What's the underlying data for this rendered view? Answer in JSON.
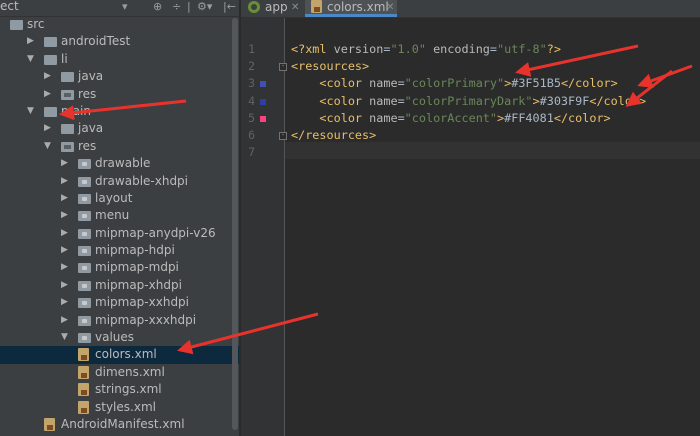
{
  "panel": {
    "title": "ect"
  },
  "tree": [
    {
      "label": "src",
      "depth": 0,
      "arrow": "",
      "icon": "folder",
      "selected": false
    },
    {
      "label": "androidTest",
      "depth": 1,
      "arrow": "right",
      "icon": "folder",
      "selected": false
    },
    {
      "label": "li",
      "depth": 1,
      "arrow": "down",
      "icon": "folder",
      "selected": false
    },
    {
      "label": "java",
      "depth": 2,
      "arrow": "right",
      "icon": "folder",
      "selected": false
    },
    {
      "label": "res",
      "depth": 2,
      "arrow": "right",
      "icon": "res-folder",
      "selected": false
    },
    {
      "label": "main",
      "depth": 1,
      "arrow": "down",
      "icon": "folder",
      "selected": false
    },
    {
      "label": "java",
      "depth": 2,
      "arrow": "right",
      "icon": "folder",
      "selected": false
    },
    {
      "label": "res",
      "depth": 2,
      "arrow": "down",
      "icon": "res-folder",
      "selected": false
    },
    {
      "label": "drawable",
      "depth": 3,
      "arrow": "right",
      "icon": "package-folder",
      "selected": false
    },
    {
      "label": "drawable-xhdpi",
      "depth": 3,
      "arrow": "right",
      "icon": "package-folder",
      "selected": false
    },
    {
      "label": "layout",
      "depth": 3,
      "arrow": "right",
      "icon": "package-folder",
      "selected": false
    },
    {
      "label": "menu",
      "depth": 3,
      "arrow": "right",
      "icon": "package-folder",
      "selected": false
    },
    {
      "label": "mipmap-anydpi-v26",
      "depth": 3,
      "arrow": "right",
      "icon": "package-folder",
      "selected": false
    },
    {
      "label": "mipmap-hdpi",
      "depth": 3,
      "arrow": "right",
      "icon": "package-folder",
      "selected": false
    },
    {
      "label": "mipmap-mdpi",
      "depth": 3,
      "arrow": "right",
      "icon": "package-folder",
      "selected": false
    },
    {
      "label": "mipmap-xhdpi",
      "depth": 3,
      "arrow": "right",
      "icon": "package-folder",
      "selected": false
    },
    {
      "label": "mipmap-xxhdpi",
      "depth": 3,
      "arrow": "right",
      "icon": "package-folder",
      "selected": false
    },
    {
      "label": "mipmap-xxxhdpi",
      "depth": 3,
      "arrow": "right",
      "icon": "package-folder",
      "selected": false
    },
    {
      "label": "values",
      "depth": 3,
      "arrow": "down",
      "icon": "package-folder",
      "selected": false
    },
    {
      "label": "colors.xml",
      "depth": 4,
      "arrow": "",
      "icon": "xml-file",
      "selected": true
    },
    {
      "label": "dimens.xml",
      "depth": 4,
      "arrow": "",
      "icon": "xml-file",
      "selected": false
    },
    {
      "label": "strings.xml",
      "depth": 4,
      "arrow": "",
      "icon": "xml-file",
      "selected": false
    },
    {
      "label": "styles.xml",
      "depth": 4,
      "arrow": "",
      "icon": "xml-file",
      "selected": false
    },
    {
      "label": "AndroidManifest.xml",
      "depth": 2,
      "arrow": "",
      "icon": "xml-file",
      "selected": false
    }
  ],
  "tabs": [
    {
      "label": "app",
      "icon": "android-app-icon",
      "active": false
    },
    {
      "label": "colors.xml",
      "icon": "xml-file-icon",
      "active": true
    }
  ],
  "editor": {
    "lines": [
      {
        "num": "1",
        "swatch": null,
        "tokens": [
          {
            "t": "<?xml ",
            "c": "tag"
          },
          {
            "t": "version",
            "c": "attr"
          },
          {
            "t": "=",
            "c": "txt"
          },
          {
            "t": "\"1.0\"",
            "c": "str"
          },
          {
            "t": " ",
            "c": "txt"
          },
          {
            "t": "encoding",
            "c": "attr"
          },
          {
            "t": "=",
            "c": "txt"
          },
          {
            "t": "\"utf-8\"",
            "c": "str"
          },
          {
            "t": "?>",
            "c": "tag"
          }
        ]
      },
      {
        "num": "2",
        "swatch": null,
        "fold": true,
        "tokens": [
          {
            "t": "<resources>",
            "c": "tag"
          }
        ]
      },
      {
        "num": "3",
        "swatch": "#3F51B5",
        "tokens": [
          {
            "t": "    ",
            "c": "txt"
          },
          {
            "t": "<color ",
            "c": "tag"
          },
          {
            "t": "name",
            "c": "attr"
          },
          {
            "t": "=",
            "c": "txt"
          },
          {
            "t": "\"colorPrimary\"",
            "c": "str"
          },
          {
            "t": ">",
            "c": "tag"
          },
          {
            "t": "#3F51B5",
            "c": "txt"
          },
          {
            "t": "</color>",
            "c": "tag"
          }
        ]
      },
      {
        "num": "4",
        "swatch": "#303F9F",
        "tokens": [
          {
            "t": "    ",
            "c": "txt"
          },
          {
            "t": "<color ",
            "c": "tag"
          },
          {
            "t": "name",
            "c": "attr"
          },
          {
            "t": "=",
            "c": "txt"
          },
          {
            "t": "\"colorPrimaryDark\"",
            "c": "str"
          },
          {
            "t": ">",
            "c": "tag"
          },
          {
            "t": "#303F9F",
            "c": "txt"
          },
          {
            "t": "</color>",
            "c": "tag"
          }
        ]
      },
      {
        "num": "5",
        "swatch": "#FF4081",
        "tokens": [
          {
            "t": "    ",
            "c": "txt"
          },
          {
            "t": "<color ",
            "c": "tag"
          },
          {
            "t": "name",
            "c": "attr"
          },
          {
            "t": "=",
            "c": "txt"
          },
          {
            "t": "\"colorAccent\"",
            "c": "str"
          },
          {
            "t": ">",
            "c": "tag"
          },
          {
            "t": "#FF4081",
            "c": "txt"
          },
          {
            "t": "</color>",
            "c": "tag"
          }
        ]
      },
      {
        "num": "6",
        "swatch": null,
        "fold": true,
        "tokens": [
          {
            "t": "</resources>",
            "c": "tag"
          }
        ]
      },
      {
        "num": "7",
        "swatch": null,
        "current": true,
        "tokens": []
      }
    ]
  },
  "colors": {
    "annotation_arrow": "#e8332d",
    "selection": "#0d293e",
    "tab_accent": "#4a88c7"
  }
}
